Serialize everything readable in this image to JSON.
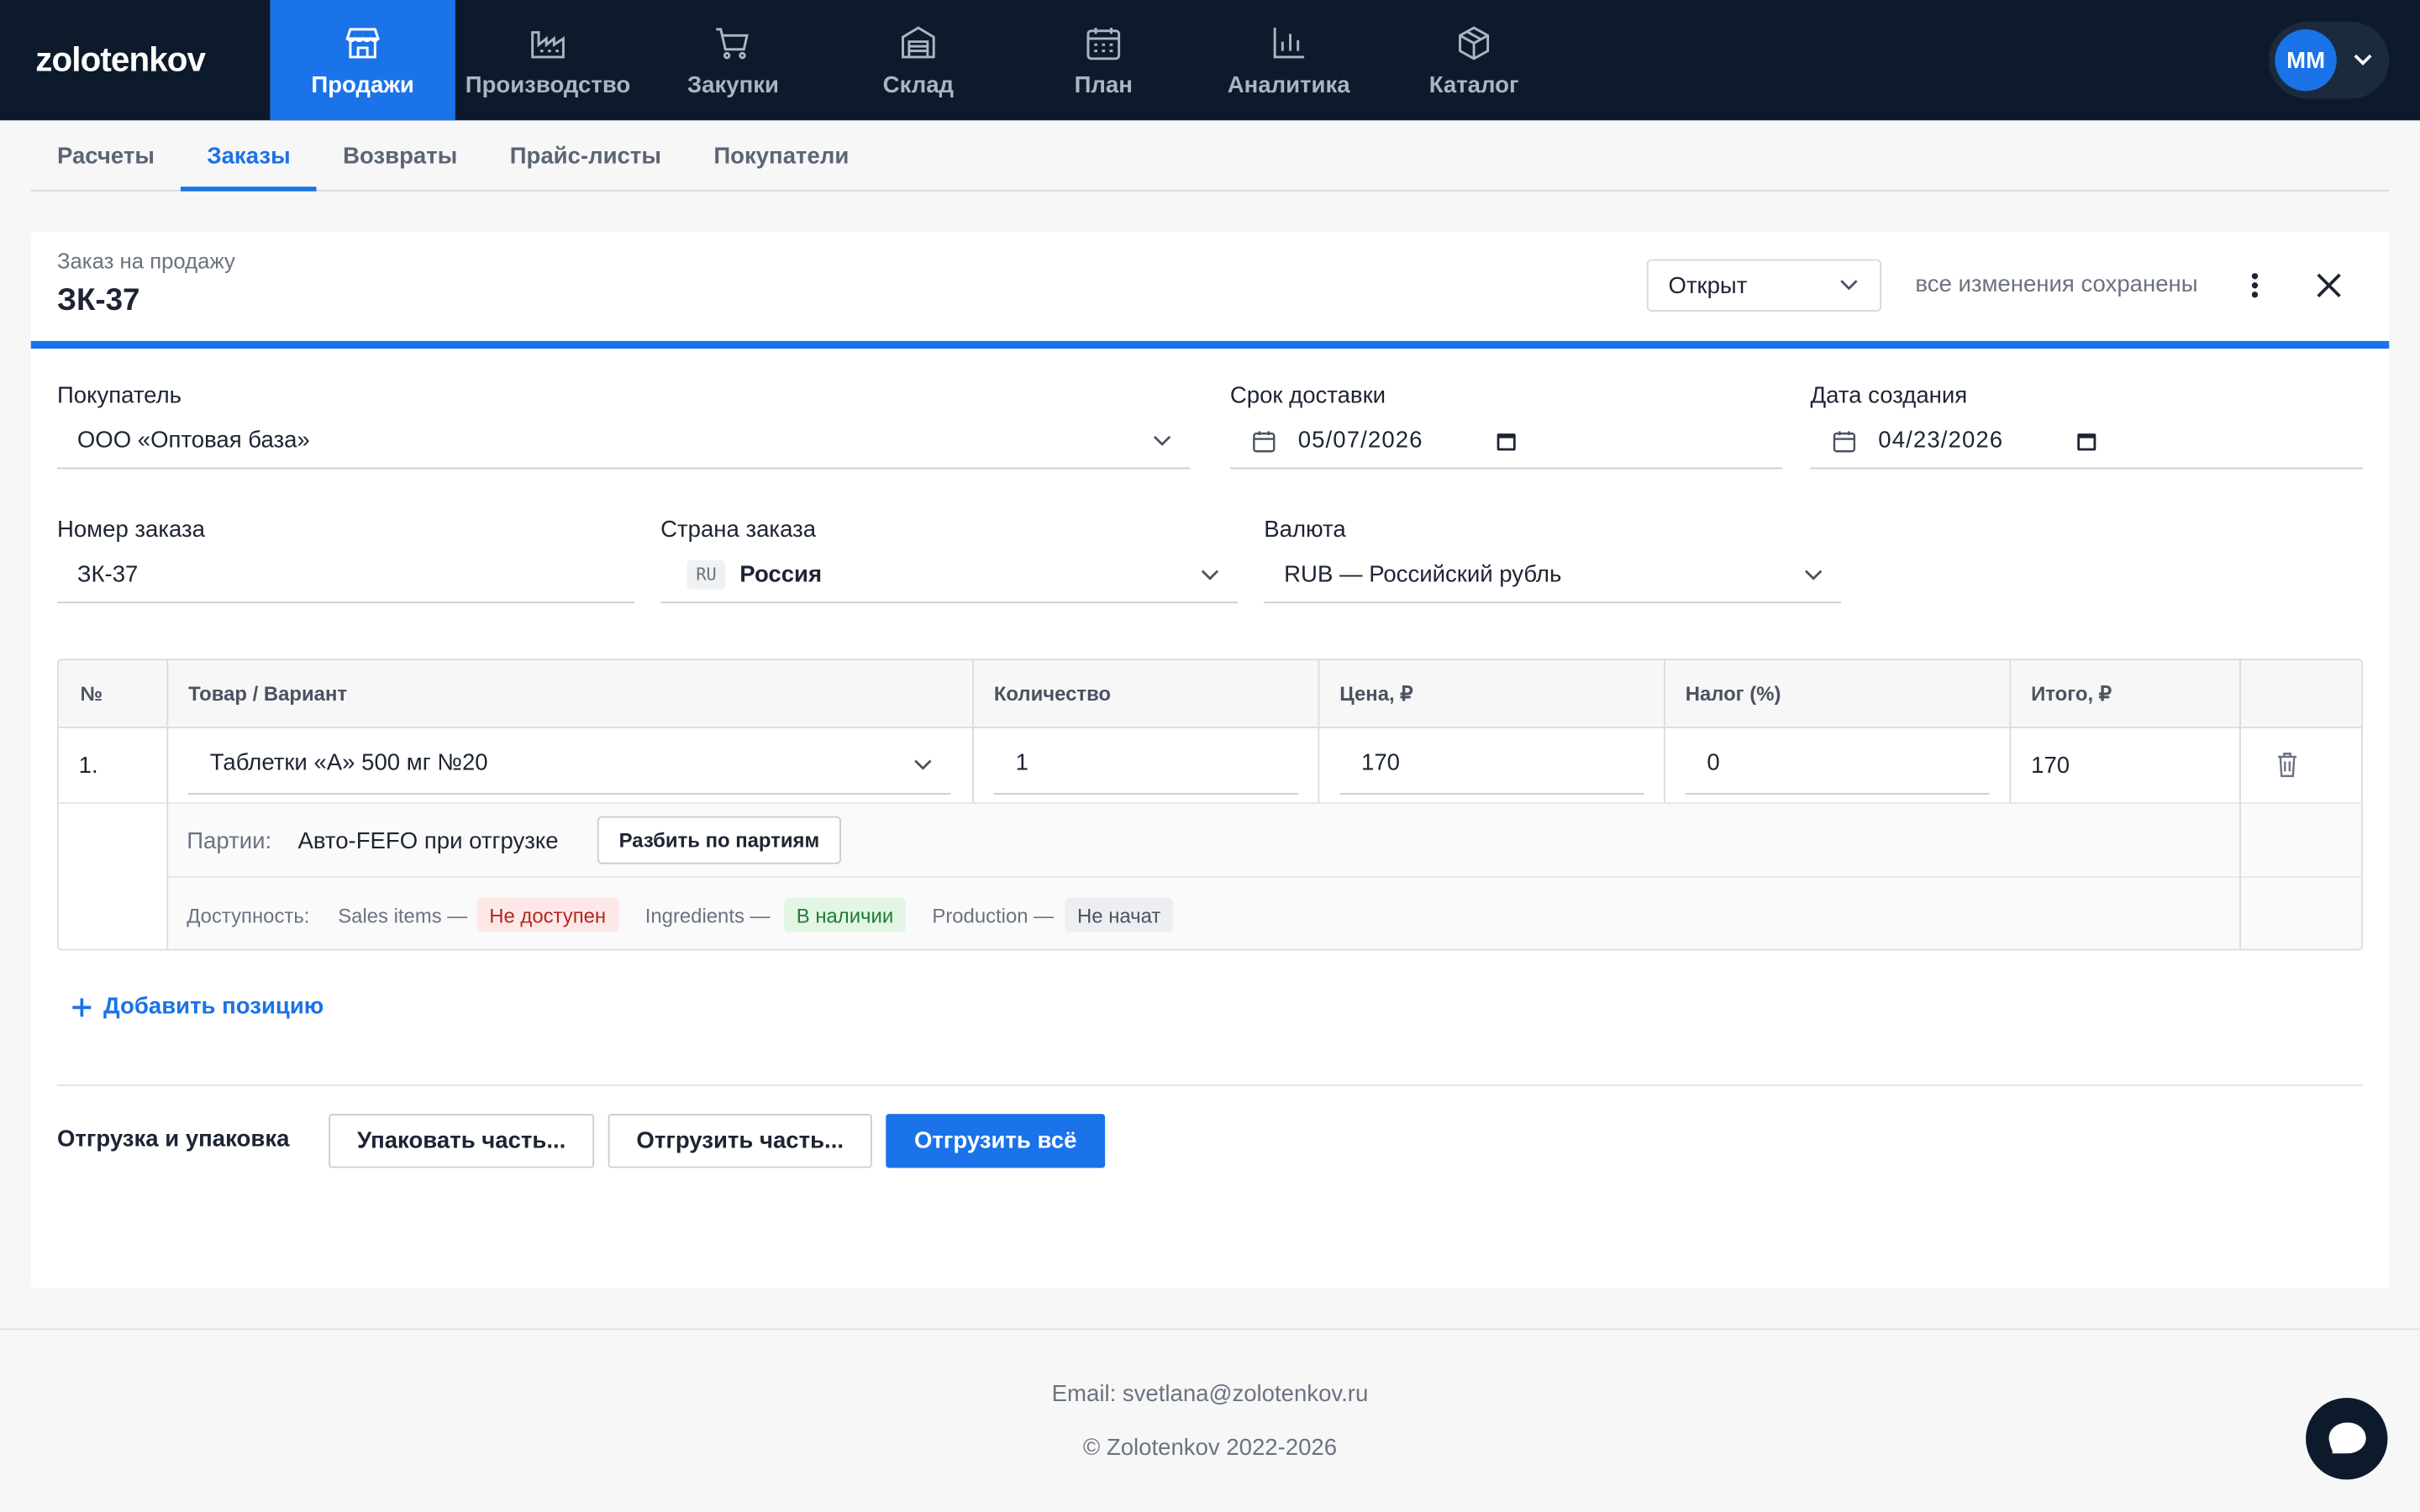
{
  "brand": "zolotenkov",
  "nav": [
    {
      "label": "Продажи",
      "icon": "store-icon",
      "active": true
    },
    {
      "label": "Производство",
      "icon": "factory-icon"
    },
    {
      "label": "Закупки",
      "icon": "cart-icon"
    },
    {
      "label": "Склад",
      "icon": "warehouse-icon"
    },
    {
      "label": "План",
      "icon": "calendar-icon"
    },
    {
      "label": "Аналитика",
      "icon": "bar-chart-icon"
    },
    {
      "label": "Каталог",
      "icon": "box-icon"
    }
  ],
  "user": {
    "initials": "MM"
  },
  "subnav": [
    {
      "label": "Расчеты"
    },
    {
      "label": "Заказы",
      "active": true
    },
    {
      "label": "Возвраты"
    },
    {
      "label": "Прайс-листы"
    },
    {
      "label": "Покупатели"
    }
  ],
  "order": {
    "doc_type": "Заказ на продажу",
    "title": "ЗК-37",
    "status": "Открыт",
    "saved_text": "все изменения сохранены"
  },
  "form": {
    "customer_label": "Покупатель",
    "customer_value": "ООО «Оптовая база»",
    "delivery_label": "Срок доставки",
    "delivery_value": "05/07/2026",
    "created_label": "Дата создания",
    "created_value": "04/23/2026",
    "number_label": "Номер заказа",
    "number_value": "ЗК-37",
    "country_label": "Страна заказа",
    "country_code": "RU",
    "country_value": "Россия",
    "currency_label": "Валюта",
    "currency_value": "RUB — Российский рубль"
  },
  "table": {
    "headers": [
      "№",
      "Товар / Вариант",
      "Количество",
      "Цена, ₽",
      "Налог (%)",
      "Итого, ₽"
    ],
    "row": {
      "num": "1.",
      "product": "Таблетки «А» 500 мг №20",
      "qty": "1",
      "price": "170",
      "tax": "0",
      "total": "170"
    },
    "batches_label": "Партии:",
    "batches_value": "Авто-FEFO при отгрузке",
    "split_button": "Разбить по партиям",
    "availability_label": "Доступность:",
    "availability": [
      {
        "label": "Sales items —",
        "status": "Не доступен",
        "color": "#b3261e",
        "bg": "#fde8e8"
      },
      {
        "label": "Ingredients —",
        "status": "В наличии",
        "color": "#1e7b34",
        "bg": "#e3f6e6"
      },
      {
        "label": "Production —",
        "status": "Не начат",
        "color": "#4a5260",
        "bg": "#eceef1"
      }
    ]
  },
  "add_line": "Добавить позицию",
  "shipping": {
    "label": "Отгрузка и упаковка",
    "pack_button": "Упаковать часть...",
    "ship_part_button": "Отгрузить часть...",
    "ship_all_button": "Отгрузить всё"
  },
  "footer": {
    "email": "Email: svetlana@zolotenkov.ru",
    "copyright": "© Zolotenkov 2022-2026"
  },
  "colors": {
    "accent": "#1a73e8",
    "topbar": "#0d1a2b"
  }
}
